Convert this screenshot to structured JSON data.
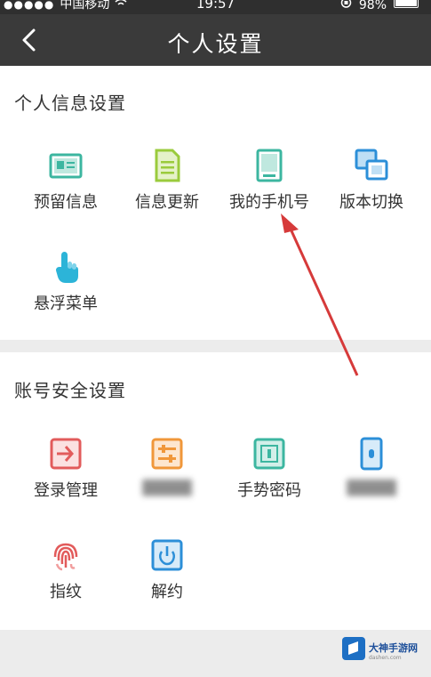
{
  "status_bar": {
    "carrier": "中国移动",
    "time": "19:57",
    "battery": "98%"
  },
  "header": {
    "title": "个人设置"
  },
  "sections": {
    "personal": {
      "title": "个人信息设置",
      "items": [
        {
          "label": "预留信息",
          "icon": "id-card-icon",
          "color": "#3cb6a0"
        },
        {
          "label": "信息更新",
          "icon": "document-icon",
          "color": "#9acb3c"
        },
        {
          "label": "我的手机号",
          "icon": "phone-icon",
          "color": "#3cb6a0"
        },
        {
          "label": "版本切换",
          "icon": "switch-version-icon",
          "color": "#2c8fd8"
        },
        {
          "label": "悬浮菜单",
          "icon": "hand-pointer-icon",
          "color": "#2cb4d8"
        }
      ]
    },
    "security": {
      "title": "账号安全设置",
      "items": [
        {
          "label": "登录管理",
          "icon": "login-icon",
          "color": "#e25b5b"
        },
        {
          "label": "",
          "icon": "settings-sliders-icon",
          "color": "#f0973a"
        },
        {
          "label": "手势密码",
          "icon": "gesture-icon",
          "color": "#3cb6a0"
        },
        {
          "label": "",
          "icon": "phone-lock-icon",
          "color": "#2c8fd8"
        },
        {
          "label": "指纹",
          "icon": "fingerprint-icon",
          "color": "#e25b5b"
        },
        {
          "label": "解约",
          "icon": "power-icon",
          "color": "#2c8fd8"
        }
      ]
    }
  },
  "watermark": {
    "name": "大神手游网",
    "url": "dashen.com"
  },
  "colors": {
    "nav_bg": "#3a3a3a",
    "annotation_arrow": "#d63a3a"
  }
}
